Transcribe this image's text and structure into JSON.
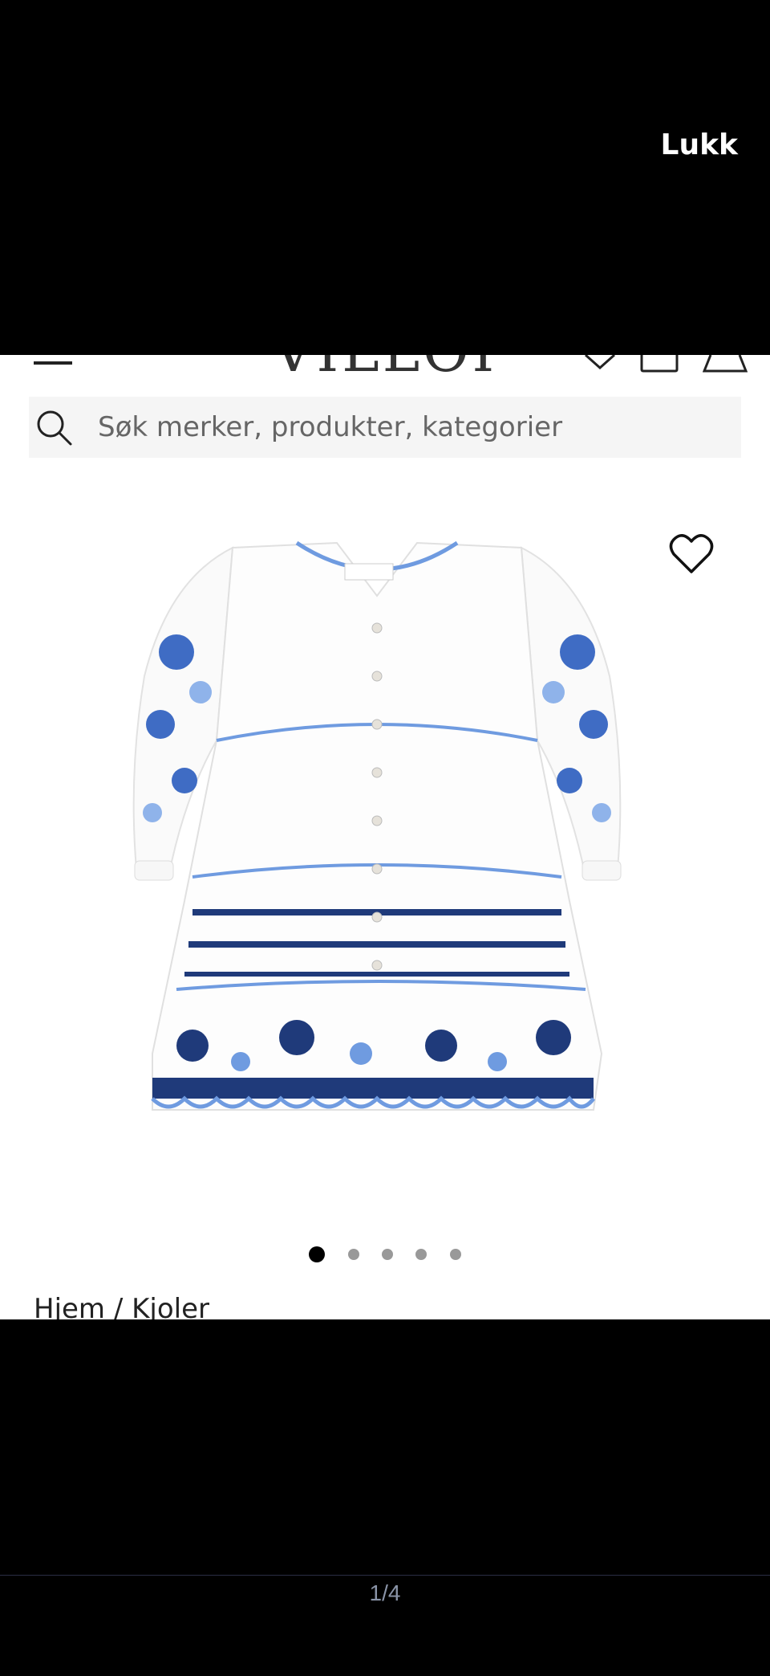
{
  "viewer": {
    "close_label": "Lukk",
    "counter": "1/4"
  },
  "header": {
    "logo_text": "VILLOID"
  },
  "search": {
    "placeholder": "Søk merker, produkter, kategorier"
  },
  "product": {
    "carousel_dots": 5,
    "active_dot": 1
  },
  "breadcrumb": "Hjem / Kjoler",
  "colors": {
    "background": "#000000",
    "page": "#ffffff",
    "embroidery_dark": "#1f3a7a",
    "embroidery_light": "#6f9be0"
  },
  "icons": [
    "close",
    "menu-icon",
    "heart-icon",
    "bag-icon",
    "search-icon"
  ]
}
